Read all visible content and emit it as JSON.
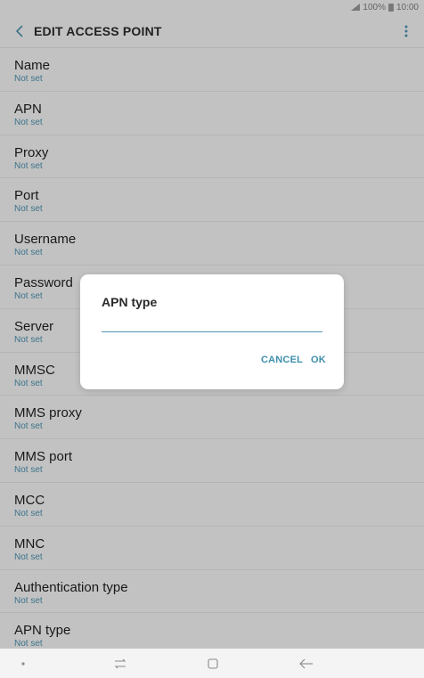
{
  "status_bar": {
    "battery": "100%",
    "time": "10:00"
  },
  "header": {
    "title": "EDIT ACCESS POINT"
  },
  "list": [
    {
      "label": "Name",
      "value": "Not set"
    },
    {
      "label": "APN",
      "value": "Not set"
    },
    {
      "label": "Proxy",
      "value": "Not set"
    },
    {
      "label": "Port",
      "value": "Not set"
    },
    {
      "label": "Username",
      "value": "Not set"
    },
    {
      "label": "Password",
      "value": "Not set"
    },
    {
      "label": "Server",
      "value": "Not set"
    },
    {
      "label": "MMSC",
      "value": "Not set"
    },
    {
      "label": "MMS proxy",
      "value": "Not set"
    },
    {
      "label": "MMS port",
      "value": "Not set"
    },
    {
      "label": "MCC",
      "value": "Not set"
    },
    {
      "label": "MNC",
      "value": "Not set"
    },
    {
      "label": "Authentication type",
      "value": "Not set"
    },
    {
      "label": "APN type",
      "value": "Not set"
    }
  ],
  "dialog": {
    "title": "APN type",
    "input_value": "",
    "cancel_label": "CANCEL",
    "ok_label": "OK"
  },
  "colors": {
    "accent": "#4e94b1",
    "background": "#f7f7f7"
  }
}
